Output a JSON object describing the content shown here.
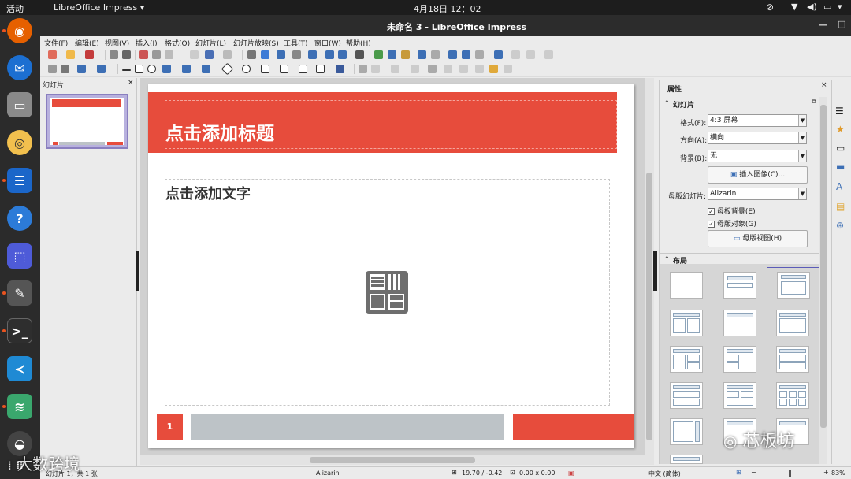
{
  "topbar": {
    "activities": "活动",
    "app_name": "LibreOffice Impress",
    "clock": "4月18日  12：02"
  },
  "window": {
    "title": "未命名 3 - LibreOffice Impress"
  },
  "menus": [
    "文件(F)",
    "编辑(E)",
    "视图(V)",
    "插入(I)",
    "格式(O)",
    "幻灯片(L)",
    "幻灯片放映(S)",
    "工具(T)",
    "窗口(W)",
    "帮助(H)"
  ],
  "slides_panel": {
    "title": "幻灯片",
    "thumb_number": "1"
  },
  "slide": {
    "title_placeholder": "点击添加标题",
    "content_placeholder": "点击添加文字",
    "footer_number": "1"
  },
  "sidebar": {
    "title": "属性",
    "section_slide": "幻灯片",
    "format_label": "格式(F):",
    "format_value": "4:3 屏幕",
    "orientation_label": "方向(A):",
    "orientation_value": "横向",
    "background_label": "背景(B):",
    "background_value": "无",
    "insert_image_button": "插入图像(C)...",
    "master_label": "母版幻灯片:",
    "master_value": "Alizarin",
    "master_bg_check": "母板背景(E)",
    "master_obj_check": "母版对象(G)",
    "master_view_button": "母版视图(H)",
    "section_layout": "布局"
  },
  "statusbar": {
    "slide_info": "幻灯片 1，共 1 张",
    "master_name": "Alizarin",
    "position": "19.70 / -0.42",
    "size": "0.00 x 0.00",
    "language": "中文 (简体)",
    "zoom": "83%"
  },
  "watermarks": {
    "left": "大数跨境",
    "right": "芯板坊"
  },
  "colors": {
    "accent": "#e74c3c",
    "footer_gray": "#bdc3c7",
    "ubuntu_orange": "#e95420"
  }
}
